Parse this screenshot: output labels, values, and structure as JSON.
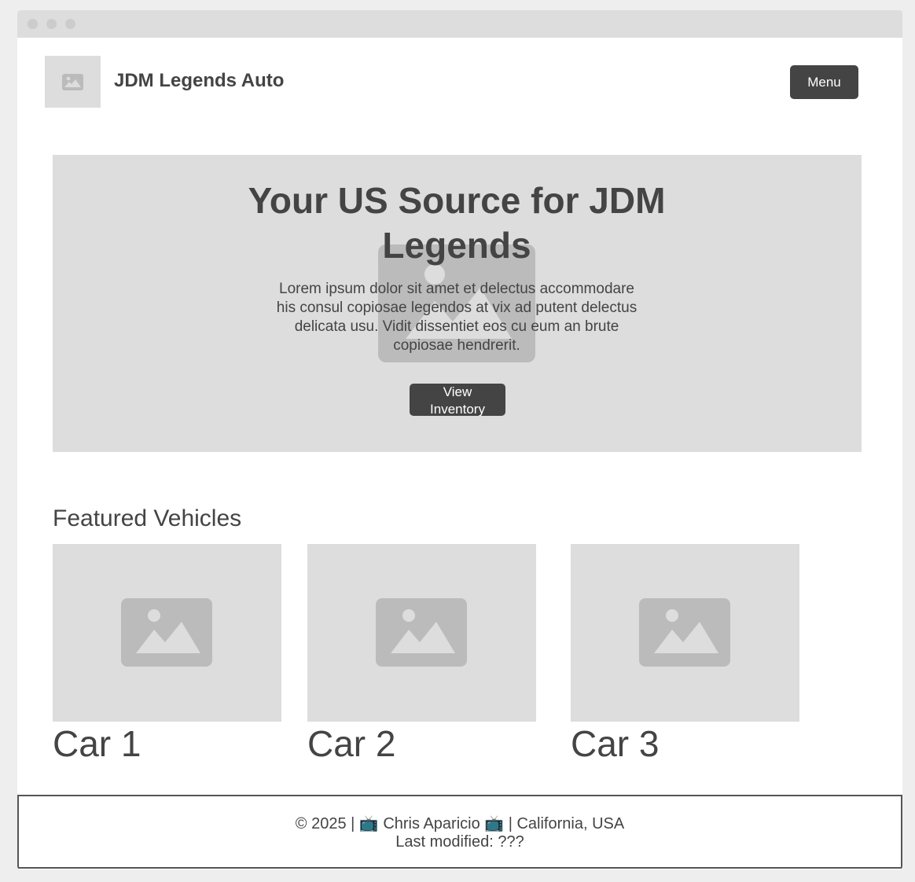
{
  "header": {
    "brand": "JDM Legends Auto",
    "menu_label": "Menu"
  },
  "hero": {
    "title": "Your US Source for JDM Legends",
    "text": "Lorem ipsum dolor sit amet et delectus accommodare his consul copiosae legendos at vix ad putent delectus delicata usu. Vidit dissentiet eos cu eum an brute copiosae hendrerit.",
    "button_label": "View Inventory"
  },
  "featured": {
    "title": "Featured Vehicles",
    "cards": [
      {
        "title": "Car 1"
      },
      {
        "title": "Car 2"
      },
      {
        "title": "Car 3"
      }
    ]
  },
  "footer": {
    "line1": "© 2025 | 📺 Chris Aparicio 📺 | California, USA",
    "line2": "Last modified: ???"
  },
  "colors": {
    "background": "#eeeeee",
    "placeholder": "#dddddd",
    "placeholder_icon": "#bbbbbb",
    "dark": "#444444"
  }
}
